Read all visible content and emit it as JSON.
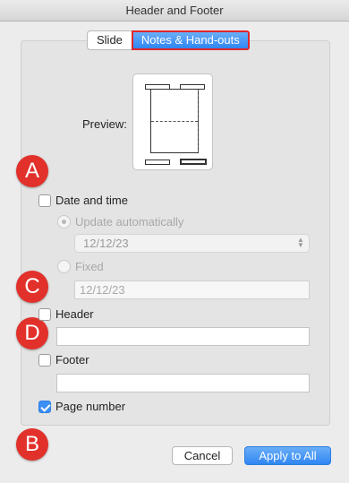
{
  "window": {
    "title": "Header and Footer"
  },
  "tabs": [
    {
      "label": "Slide",
      "selected": false
    },
    {
      "label": "Notes & Hand-outs",
      "selected": true
    }
  ],
  "preview": {
    "label": "Preview:"
  },
  "annotations": [
    "A",
    "C",
    "D",
    "B"
  ],
  "date_and_time": {
    "label": "Date and time",
    "checked": false,
    "update_automatically": {
      "label": "Update automatically",
      "selected": true,
      "value": "12/12/23"
    },
    "fixed": {
      "label": "Fixed",
      "selected": false,
      "value": "12/12/23"
    }
  },
  "header": {
    "label": "Header",
    "checked": false,
    "value": ""
  },
  "footer": {
    "label": "Footer",
    "checked": false,
    "value": ""
  },
  "page_number": {
    "label": "Page number",
    "checked": true
  },
  "buttons": {
    "cancel": "Cancel",
    "apply": "Apply to All"
  },
  "colors": {
    "accent": "#2f86f2",
    "annotation": "#e2302b",
    "highlight_border": "#e0262a"
  }
}
